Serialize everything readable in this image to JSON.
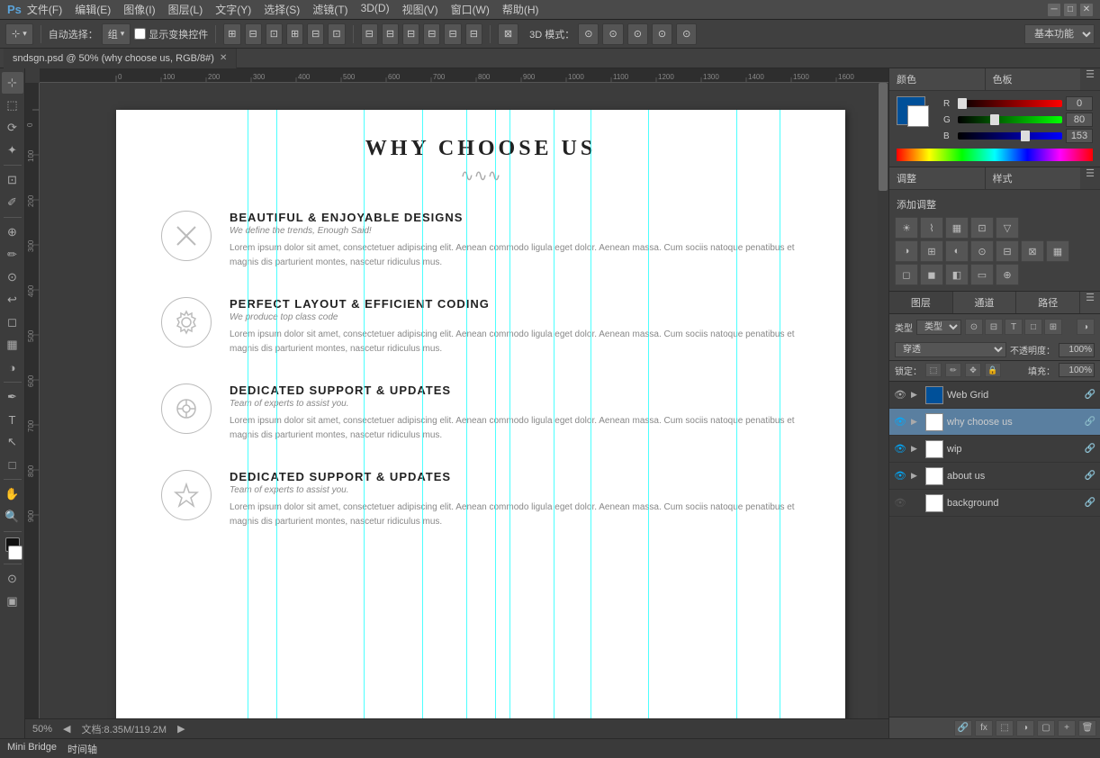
{
  "titlebar": {
    "appname": "Ps",
    "menus": [
      "文件(F)",
      "编辑(E)",
      "图像(I)",
      "图层(L)",
      "文字(Y)",
      "选择(S)",
      "滤镜(T)",
      "3D(D)",
      "视图(V)",
      "窗口(W)",
      "帮助(H)"
    ]
  },
  "toolbar": {
    "auto_select_label": "自动选择：",
    "group_label": "组",
    "transform_label": "显示变换控件",
    "mode_label": "3D 模式：",
    "workspace_label": "基本功能"
  },
  "tabs": [
    {
      "label": "sndsgn.psd @ 50% (why choose us, RGB/8#)",
      "active": true
    }
  ],
  "canvas": {
    "zoom": "50%",
    "doc_size": "文档:8.35M/119.2M",
    "content": {
      "title": "WHY CHOOSE US",
      "divider": "∿∿∿",
      "features": [
        {
          "icon": "✕",
          "title": "BEAUTIFUL & ENJOYABLE DESIGNS",
          "subtitle": "We define the trends, Enough Said!",
          "body": "Lorem ipsum dolor sit amet, consectetuer adipiscing elit. Aenean commodo ligula eget dolor. Aenean massa. Cum sociis natoque penatibus et magnis dis parturient montes, nascetur ridiculus mus."
        },
        {
          "icon": "⚙",
          "title": "PERFECT LAYOUT & EFFICIENT CODING",
          "subtitle": "We produce top class code",
          "body": "Lorem ipsum dolor sit amet, consectetuer adipiscing elit. Aenean commodo ligula eget dolor. Aenean massa. Cum sociis natoque penatibus et magnis dis parturient montes, nascetur ridiculus mus."
        },
        {
          "icon": "✳",
          "title": "DEDICATED SUPPORT & UPDATES",
          "subtitle": "Team of experts to assist you.",
          "body": "Lorem ipsum dolor sit amet, consectetuer adipiscing elit. Aenean commodo ligula eget dolor. Aenean massa. Cum sociis natoque penatibus et magnis dis parturient montes, nascetur ridiculus mus."
        },
        {
          "icon": "★",
          "title": "DEDICATED SUPPORT & UPDATES",
          "subtitle": "Team of experts to assist you.",
          "body": "Lorem ipsum dolor sit amet, consectetuer adipiscing elit. Aenean commodo ligula eget dolor. Aenean massa. Cum sociis natoque penatibus et magnis dis parturient montes, nascetur ridiculus mus."
        }
      ]
    }
  },
  "color_panel": {
    "tab1": "颜色",
    "tab2": "色板",
    "r_label": "R",
    "g_label": "G",
    "b_label": "B",
    "r_value": "0",
    "g_value": "80",
    "b_value": "153"
  },
  "adjustments_panel": {
    "title": "调整",
    "tab2": "样式",
    "add_label": "添加调整"
  },
  "layers_panel": {
    "tab1": "图层",
    "tab2": "通道",
    "tab3": "路径",
    "type_label": "类型",
    "blend_mode": "穿透",
    "opacity_label": "不透明度：",
    "opacity_value": "100%",
    "lock_label": "锁定：",
    "fill_label": "填充：",
    "fill_value": "100%",
    "layers": [
      {
        "name": "Web Grid",
        "visible": true,
        "expanded": true,
        "active": false,
        "thumb_color": "blue"
      },
      {
        "name": "why choose us",
        "visible": true,
        "expanded": false,
        "active": true,
        "thumb_color": "white"
      },
      {
        "name": "wip",
        "visible": true,
        "expanded": false,
        "active": false,
        "thumb_color": "white"
      },
      {
        "name": "about us",
        "visible": true,
        "expanded": false,
        "active": false,
        "thumb_color": "white"
      },
      {
        "name": "background",
        "visible": false,
        "expanded": false,
        "active": false,
        "thumb_color": "white"
      }
    ]
  },
  "bottom": {
    "tab1": "Mini Bridge",
    "tab2": "时间轴"
  },
  "ruler_marks": [
    "0",
    "100",
    "200",
    "300",
    "400",
    "500",
    "600",
    "700",
    "800",
    "900",
    "1000",
    "1100",
    "1200",
    "1300",
    "1400",
    "1500",
    "1600"
  ]
}
